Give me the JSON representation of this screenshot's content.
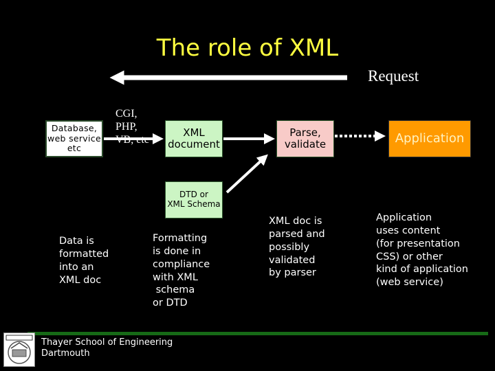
{
  "slide": {
    "title": "The role of XML",
    "request_label": "Request",
    "boxes": {
      "source": "Database,\nweb service\netc",
      "xml_document": "XML\ndocument",
      "parse": "Parse,\nvalidate",
      "application": "Application",
      "schema": "DTD or\nXML Schema"
    },
    "cgi_label": "CGI,\nPHP,\nVB, etc",
    "notes": {
      "data": "Data is\nformatted\ninto an\nXML doc",
      "format": "Formatting\nis done in\ncompliance\nwith XML\n schema\nor DTD",
      "parse": "XML doc is\nparsed and\npossibly\nvalidated\nby parser",
      "application": "Application\nuses content\n(for presentation\nCSS) or other\nkind of application\n(web service)"
    },
    "footer": {
      "text": "Thayer School of Engineering\nDartmouth"
    },
    "colors": {
      "title": "#ffff40",
      "xml_box": "#ccf5c4",
      "parse_box": "#f8cbc8",
      "app_box": "#ff9a00",
      "footer_bar": "#166a16"
    }
  }
}
